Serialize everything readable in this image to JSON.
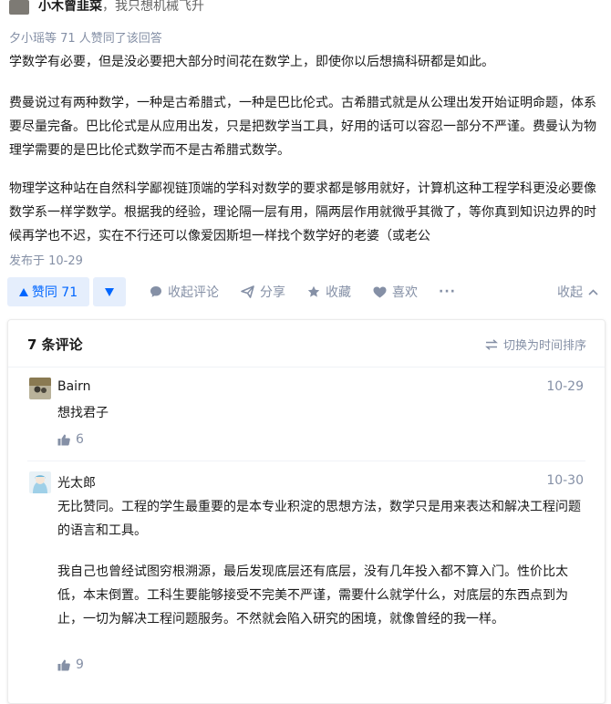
{
  "answer": {
    "author_name": "小木曾韭菜",
    "author_bio": "，我只想机械飞升",
    "vote_summary": "夕小瑶等 71 人赞同了该回答",
    "paragraphs": [
      "学数学有必要，但是没必要把大部分时间花在数学上，即使你以后想搞科研都是如此。",
      "费曼说过有两种数学，一种是古希腊式，一种是巴比伦式。古希腊式就是从公理出发开始证明命题，体系要尽量完备。巴比伦式是从应用出发，只是把数学当工具，好用的话可以容忍一部分不严谨。费曼认为物理学需要的是巴比伦式数学而不是古希腊式数学。",
      "物理学这种站在自然科学鄙视链顶端的学科对数学的要求都是够用就好，计算机这种工程学科更没必要像数学系一样学数学。根据我的经验，理论隔一层有用，隔两层作用就微乎其微了，等你真到知识边界的时候再学也不迟，实在不行还可以像爱因斯坦一样找个数学好的老婆（或老公"
    ],
    "published": "发布于 10-29"
  },
  "actions": {
    "vote_up_label": "赞同 71",
    "collapse_comments": "收起评论",
    "share": "分享",
    "favorite": "收藏",
    "like": "喜欢",
    "more": "···",
    "collapse": "收起"
  },
  "comments": {
    "count_label": "7 条评论",
    "sort_label": "切换为时间排序",
    "items": [
      {
        "name": "Bairn",
        "date": "10-29",
        "paragraphs": [
          "想找君子"
        ],
        "likes": "6"
      },
      {
        "name": "光太郎",
        "date": "10-30",
        "paragraphs": [
          "无比赞同。工程的学生最重要的是本专业积淀的思想方法，数学只是用来表达和解决工程问题的语言和工具。",
          "我自己也曾经试图穷根溯源，最后发现底层还有底层，没有几年投入都不算入门。性价比太低，本末倒置。工科生要能够接受不完美不严谨，需要什么就学什么，对底层的东西点到为止，一切为解决工程问题服务。不然就会陷入研究的困境，就像曾经的我一样。"
        ],
        "likes": "9"
      }
    ]
  },
  "colors": {
    "accent": "#0066ff",
    "accent_bg": "#e5eefc",
    "muted": "#8590a6"
  }
}
